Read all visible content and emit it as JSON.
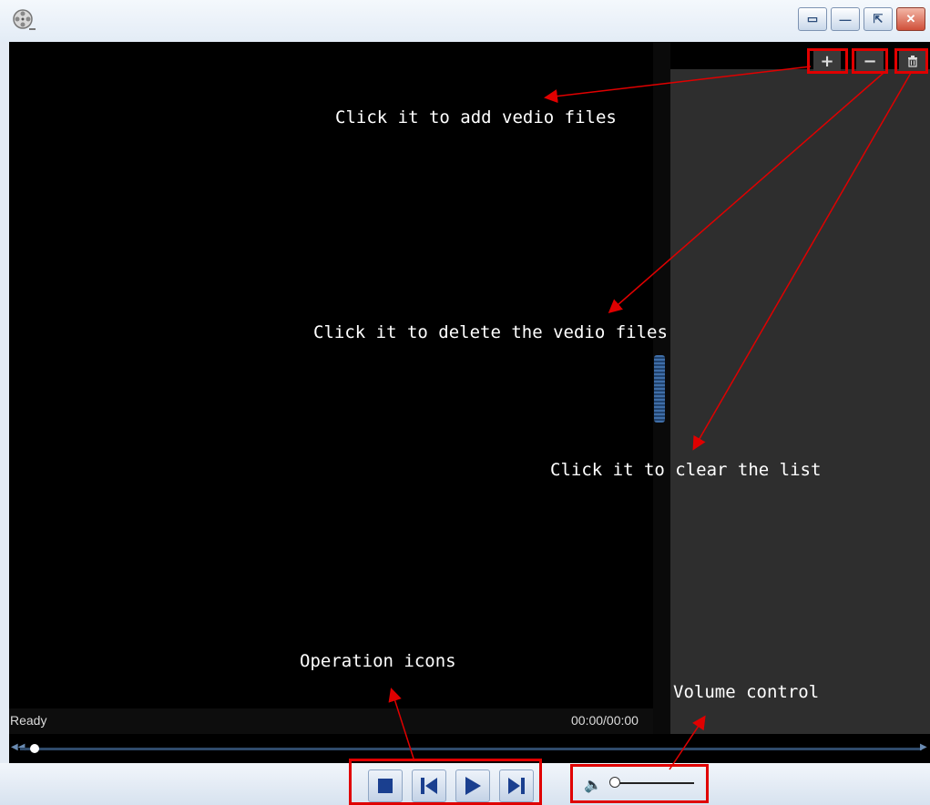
{
  "window": {
    "buttons": [
      "▭",
      "—",
      "⇱",
      "✕"
    ]
  },
  "playlist_toolbar": {
    "add_label": "+",
    "remove_label": "−",
    "clear_icon": "trash-icon"
  },
  "status": {
    "text": "Ready",
    "time": "00:00/00:00"
  },
  "seek": {
    "progress": 0
  },
  "volume": {
    "level": 0
  },
  "annotations": {
    "add": "Click it to add vedio files",
    "delete": "Click it to delete the vedio files",
    "clear": "Click it to clear the list",
    "operation": "Operation icons",
    "volume": "Volume control"
  },
  "colors": {
    "highlight": "#e00000",
    "video_bg": "#000000",
    "playlist_bg": "#2e2e2e"
  }
}
